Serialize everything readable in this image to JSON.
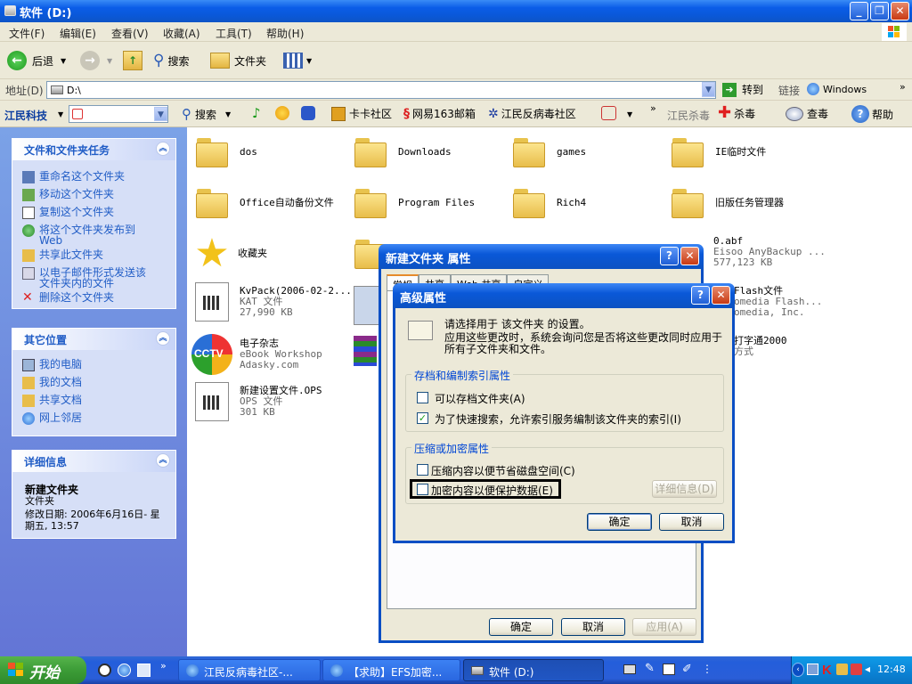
{
  "window": {
    "title": "软件  (D:)"
  },
  "menu": [
    "文件(F)",
    "编辑(E)",
    "查看(V)",
    "收藏(A)",
    "工具(T)",
    "帮助(H)"
  ],
  "toolbar": {
    "back": "后退",
    "search": "搜索",
    "folders": "文件夹"
  },
  "address": {
    "label": "地址(D)",
    "value": "D:\\",
    "go": "转到",
    "links": "链接",
    "links_item": "Windows"
  },
  "linksbar": {
    "brand": "江民科技",
    "search": "搜索",
    "kaka": "卡卡社区",
    "mail163": "网易163邮箱",
    "community": "江民反病毒社区",
    "jiangmin_kill": "江民杀毒",
    "kill": "杀毒",
    "scan": "查毒",
    "help": "帮助"
  },
  "sidebar": {
    "tasks_title": "文件和文件夹任务",
    "tasks": [
      "重命名这个文件夹",
      "移动这个文件夹",
      "复制这个文件夹",
      "将这个文件夹发布到 Web",
      "共享此文件夹",
      "以电子邮件形式发送该文件夹内的文件",
      "删除这个文件夹"
    ],
    "places_title": "其它位置",
    "places": [
      "我的电脑",
      "我的文档",
      "共享文档",
      "网上邻居"
    ],
    "details_title": "详细信息",
    "details_name": "新建文件夹",
    "details_type": "文件夹",
    "details_modified": "修改日期: 2006年6月16日- 星期五, 13:57"
  },
  "files": [
    {
      "name": "dos"
    },
    {
      "name": "Downloads"
    },
    {
      "name": "games"
    },
    {
      "name": "IE临时文件"
    },
    {
      "name": "Office自动备份文件"
    },
    {
      "name": "Program Files"
    },
    {
      "name": "Rich4"
    },
    {
      "name": "旧版任务管理器"
    },
    {
      "name": "收藏夹"
    },
    {
      "name": "0.abf",
      "line2": "Eisoo AnyBackup ...",
      "line3": "577,123 KB"
    },
    {
      "name": "KvPack(2006-02-2...",
      "line2": "KAT 文件",
      "line3": "27,990 KB"
    },
    {
      "name": "Flash文件",
      "line2": "omedia Flash...",
      "line3": "omedia, Inc."
    },
    {
      "name": "电子杂志",
      "line2": "eBook Workshop",
      "line3": "Adasky.com"
    },
    {
      "name": "打字通2000",
      "line2": "方式"
    },
    {
      "name": "新建设置文件.OPS",
      "line2": "OPS 文件",
      "line3": "301 KB"
    }
  ],
  "props_dialog": {
    "title": "新建文件夹  属性",
    "tabs": [
      "常规",
      "共享",
      "Web 共享",
      "自定义"
    ],
    "ok": "确定",
    "cancel": "取消",
    "apply": "应用(A)"
  },
  "adv_dialog": {
    "title": "高级属性",
    "intro": "请选择用于 该文件夹 的设置。",
    "intro2": "应用这些更改时，系统会询问您是否将这些更改同时应用于所有子文件夹和文件。",
    "group1": "存档和编制索引属性",
    "archive": "可以存档文件夹(A)",
    "index": "为了快速搜索，允许索引服务编制该文件夹的索引(I)",
    "archive_checked": false,
    "index_checked": true,
    "group2": "压缩或加密属性",
    "compress": "压缩内容以便节省磁盘空间(C)",
    "encrypt": "加密内容以便保护数据(E)",
    "compress_checked": false,
    "encrypt_checked": false,
    "details": "详细信息(D)",
    "ok": "确定",
    "cancel": "取消"
  },
  "taskbar": {
    "start": "开始",
    "items": [
      "江民反病毒社区-...",
      "【求助】EFS加密...",
      "软件  (D:)"
    ],
    "clock": "12:48"
  },
  "colors": {
    "xp_blue": "#0a58d8",
    "start_green": "#3c9c37",
    "task_panel": "#d6dff7",
    "link_blue": "#215dc6"
  }
}
